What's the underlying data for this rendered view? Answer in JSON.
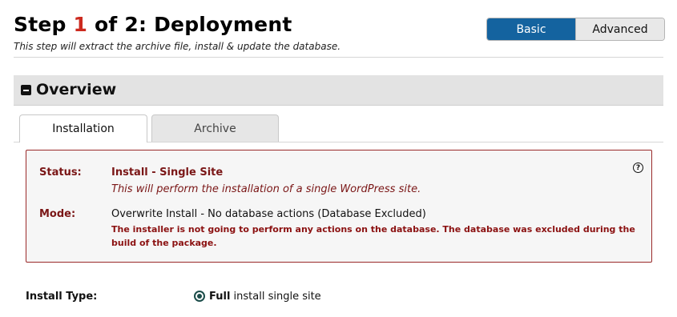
{
  "header": {
    "title_prefix": "Step ",
    "step_number": "1",
    "title_suffix": " of 2: Deployment",
    "subtitle": "This step will extract the archive file, install & update the database."
  },
  "mode_toggle": {
    "basic_label": "Basic",
    "advanced_label": "Advanced",
    "selected": "Basic"
  },
  "overview": {
    "title": "Overview",
    "icon": "collapse-minus-icon"
  },
  "tabs": [
    {
      "label": "Installation",
      "active": true
    },
    {
      "label": "Archive",
      "active": false
    }
  ],
  "status_box": {
    "status_label": "Status:",
    "status_value": "Install - Single Site",
    "status_description": "This will perform the installation of a single WordPress site.",
    "mode_label": "Mode:",
    "mode_value": "Overwrite Install - No database actions (Database Excluded)",
    "mode_warning": "The installer is not going to perform any actions on the database. The database was excluded during the build of the package.",
    "help_icon_glyph": "?"
  },
  "install_type": {
    "label": "Install Type:",
    "option_bold": "Full",
    "option_rest": " install single site",
    "selected": true
  },
  "colors": {
    "accent_blue": "#14639f",
    "step_number_red": "#cc2a1f",
    "status_text": "#7a1616",
    "box_border": "#9a2a2a"
  }
}
